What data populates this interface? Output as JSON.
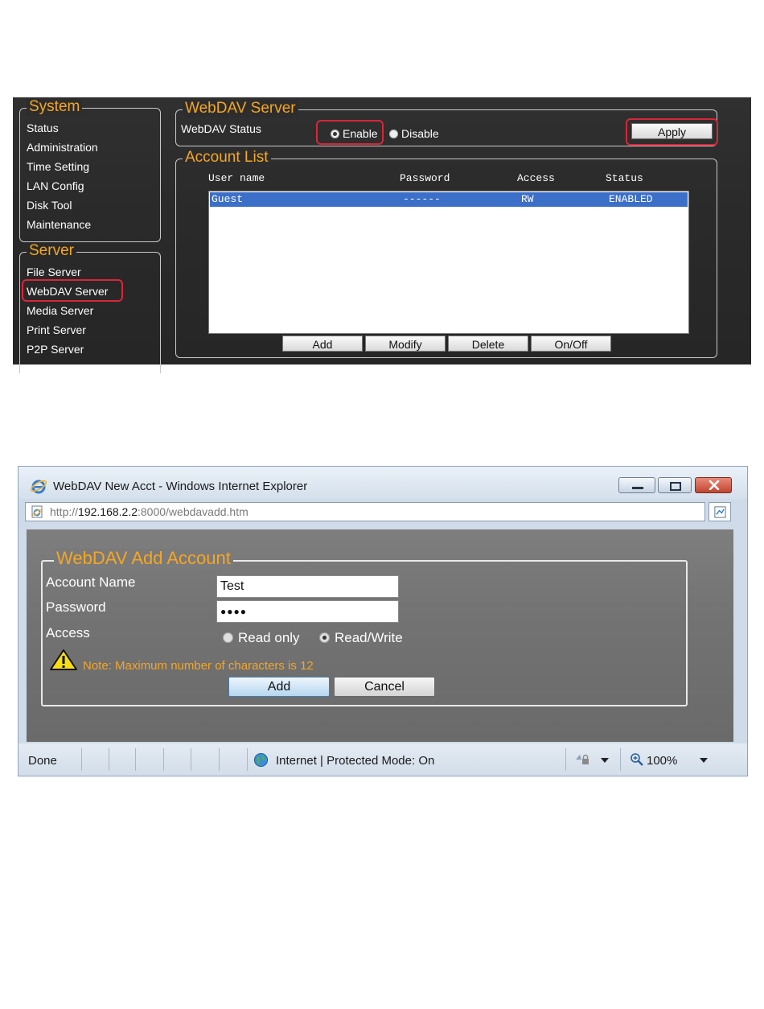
{
  "shot1": {
    "system_legend": "System",
    "system_menu": [
      "Status",
      "Administration",
      "Time Setting",
      "LAN Config",
      "Disk Tool",
      "Maintenance"
    ],
    "server_legend": "Server",
    "server_menu": [
      "File Server",
      "WebDAV Server",
      "Media Server",
      "Print Server",
      "P2P Server"
    ],
    "webdav_legend": "WebDAV Server",
    "webdav_status_label": "WebDAV Status",
    "enable_label": "Enable",
    "disable_label": "Disable",
    "apply_label": "Apply",
    "account_legend": "Account List",
    "columns": [
      "User name",
      "Password",
      "Access",
      "Status"
    ],
    "rows": [
      {
        "user": "Guest",
        "password": "------",
        "access": "RW",
        "status": "ENABLED"
      }
    ],
    "buttons": [
      "Add",
      "Modify",
      "Delete",
      "On/Off"
    ],
    "colors": {
      "legend": "#f5a623",
      "highlight": "#d8263a",
      "row_selected": "#3b6fc8"
    }
  },
  "shot2": {
    "window_title": "WebDAV New Acct - Windows Internet Explorer",
    "url_host": "http://",
    "url_ip": "192.168.2.2",
    "url_rest": ":8000/webdavadd.htm",
    "form_legend": "WebDAV Add Account",
    "account_name_label": "Account Name",
    "account_name_value": "Test",
    "password_label": "Password",
    "password_value": "●●●●",
    "access_label": "Access",
    "read_only_label": "Read only",
    "read_write_label": "Read/Write",
    "note": "Note: Maximum number of characters is 12",
    "add_label": "Add",
    "cancel_label": "Cancel",
    "status_done": "Done",
    "status_zone": "Internet | Protected Mode: On",
    "zoom": "100%",
    "icons": [
      "internet-explorer-icon",
      "warning-icon",
      "globe-icon",
      "lock-icon",
      "zoom-icon"
    ]
  }
}
